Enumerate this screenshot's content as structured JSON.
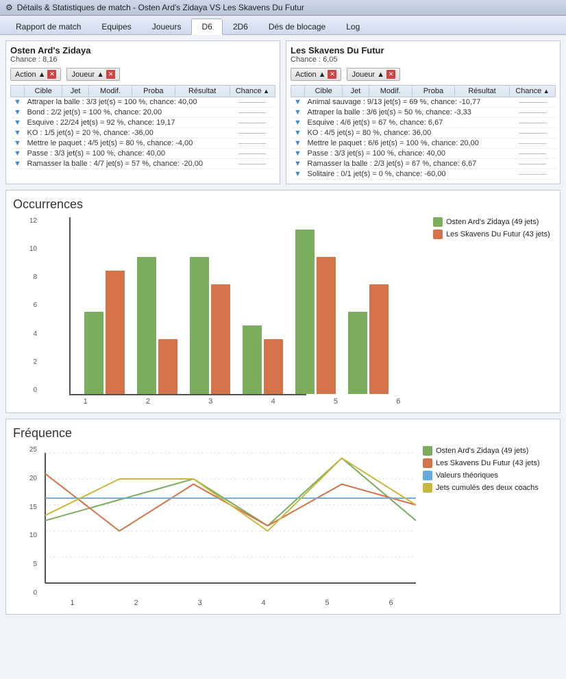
{
  "window": {
    "title": "Détails & Statistiques de match - Osten Ard's Zidaya VS Les Skavens Du Futur"
  },
  "nav": {
    "tabs": [
      {
        "label": "Rapport de match",
        "active": false
      },
      {
        "label": "Equipes",
        "active": false
      },
      {
        "label": "Joueurs",
        "active": false
      },
      {
        "label": "D6",
        "active": true
      },
      {
        "label": "2D6",
        "active": false
      },
      {
        "label": "Dés de blocage",
        "active": false
      },
      {
        "label": "Log",
        "active": false
      }
    ]
  },
  "teams": {
    "left": {
      "name": "Osten Ard's Zidaya",
      "chance_label": "Chance : 8,16",
      "action_filter": "Action",
      "joueur_filter": "Joueur",
      "columns": [
        "Cible",
        "Jet",
        "Modif.",
        "Proba",
        "Résultat",
        "Chance"
      ],
      "rows": [
        {
          "text": "Attraper la balle : 3/3 jet(s) = 100 %, chance: 40,00"
        },
        {
          "text": "Bond : 2/2 jet(s) = 100 %, chance: 20,00"
        },
        {
          "text": "Esquive : 22/24 jet(s) = 92 %, chance: 19,17"
        },
        {
          "text": "KO : 1/5 jet(s) = 20 %, chance: -36,00"
        },
        {
          "text": "Mettre le paquet : 4/5 jet(s) = 80 %, chance: -4,00"
        },
        {
          "text": "Passe : 3/3 jet(s) = 100 %, chance: 40,00"
        },
        {
          "text": "Ramasser la balle : 4/7 jet(s) = 57 %, chance: -20,00"
        }
      ]
    },
    "right": {
      "name": "Les Skavens Du Futur",
      "chance_label": "Chance : 6,05",
      "action_filter": "Action",
      "joueur_filter": "Joueur",
      "columns": [
        "Cible",
        "Jet",
        "Modif.",
        "Proba",
        "Résultat",
        "Chance"
      ],
      "rows": [
        {
          "text": "Animal sauvage : 9/13 jet(s) = 69 %, chance: -10,77"
        },
        {
          "text": "Attraper la balle : 3/6 jet(s) = 50 %, chance: -3,33"
        },
        {
          "text": "Esquive : 4/6 jet(s) = 67 %, chance: 6,67"
        },
        {
          "text": "KO : 4/5 jet(s) = 80 %, chance: 36,00"
        },
        {
          "text": "Mettre le paquet : 6/6 jet(s) = 100 %, chance: 20,00"
        },
        {
          "text": "Passe : 3/3 jet(s) = 100 %, chance: 40,00"
        },
        {
          "text": "Ramasser la balle : 2/3 jet(s) = 67 %, chance: 6,67"
        },
        {
          "text": "Solitaire : 0/1 jet(s) = 0 %, chance: -60,00"
        }
      ]
    }
  },
  "occurrences": {
    "title": "Occurrences",
    "legend": [
      {
        "label": "Osten Ard's Zidaya (49 jets)",
        "color": "#7aad5c"
      },
      {
        "label": "Les Skavens Du Futur (43 jets)",
        "color": "#d4724a"
      }
    ],
    "yLabels": [
      "0",
      "2",
      "4",
      "6",
      "8",
      "10",
      "12"
    ],
    "xLabels": [
      "1",
      "2",
      "3",
      "4",
      "5",
      "6"
    ],
    "bars": [
      {
        "green": 6,
        "orange": 9
      },
      {
        "green": 10,
        "orange": 4
      },
      {
        "green": 10,
        "orange": 8
      },
      {
        "green": 5,
        "orange": 4
      },
      {
        "green": 12,
        "orange": 10
      },
      {
        "green": 6,
        "orange": 8
      }
    ],
    "maxY": 12
  },
  "frequence": {
    "title": "Fréquence",
    "legend": [
      {
        "label": "Osten Ard's Zidaya (49 jets)",
        "color": "#7aad5c"
      },
      {
        "label": "Les Skavens Du Futur (43 jets)",
        "color": "#d4724a"
      },
      {
        "label": "Valeurs théoriques",
        "color": "#66aadd"
      },
      {
        "label": "Jets cumulés des deux coachs",
        "color": "#c8b840"
      }
    ],
    "yLabels": [
      "0",
      "5",
      "10",
      "15",
      "20",
      "25"
    ],
    "xLabels": [
      "1",
      "2",
      "3",
      "4",
      "5",
      "6"
    ],
    "green": [
      12,
      16,
      20,
      11,
      24,
      12
    ],
    "orange": [
      21,
      10,
      19,
      11,
      19,
      15
    ],
    "blue": [
      16.3,
      16.3,
      16.3,
      16.3,
      16.3,
      16.3
    ],
    "yellow": [
      13,
      20,
      20,
      10,
      24,
      15
    ],
    "maxY": 25
  }
}
